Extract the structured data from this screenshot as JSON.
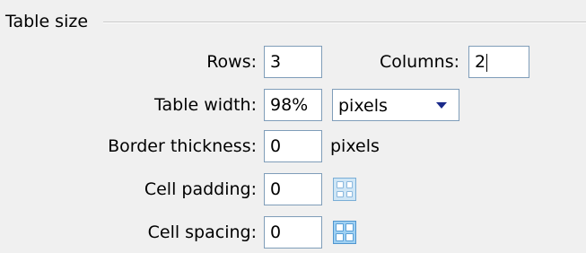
{
  "group": {
    "legend": "Table size"
  },
  "rows": {
    "label": "Rows:",
    "value": "3"
  },
  "columns": {
    "label": "Columns:",
    "value": "2"
  },
  "table_width": {
    "label": "Table width:",
    "value": "98%",
    "unit_selected": "pixels"
  },
  "border_thickness": {
    "label": "Border thickness:",
    "value": "0",
    "unit": "pixels"
  },
  "cell_padding": {
    "label": "Cell padding:",
    "value": "0",
    "icon": "cell-padding-icon"
  },
  "cell_spacing": {
    "label": "Cell spacing:",
    "value": "0",
    "icon": "cell-spacing-icon"
  },
  "colors": {
    "background": "#f0f0f0",
    "field_border": "#7f9db9",
    "dropdown_arrow": "#1a2a8a"
  }
}
